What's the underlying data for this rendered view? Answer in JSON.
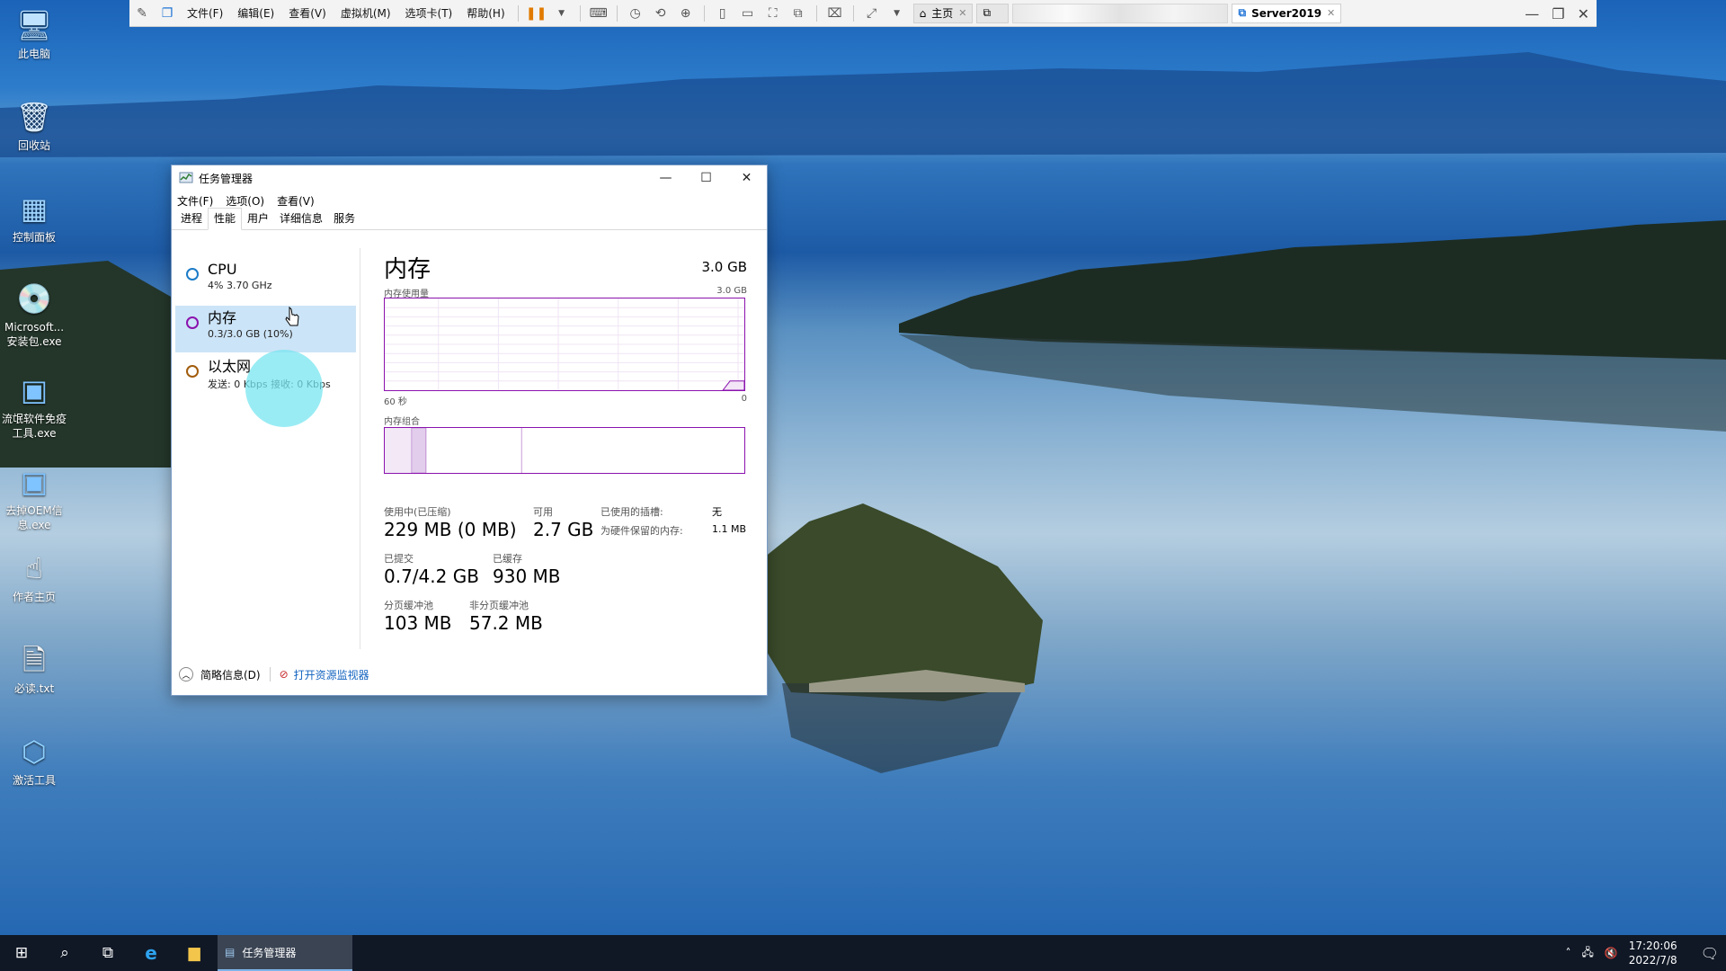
{
  "vm_toolbar": {
    "menus": [
      "文件(F)",
      "编辑(E)",
      "查看(V)",
      "虚拟机(M)",
      "选项卡(T)",
      "帮助(H)"
    ],
    "home_tab": "主页",
    "active_tab": "Server2019"
  },
  "desktop_icons": [
    {
      "label": "此电脑",
      "icon": "computer-icon"
    },
    {
      "label": "回收站",
      "icon": "recycle-bin-icon"
    },
    {
      "label": "控制面板",
      "icon": "control-panel-icon"
    },
    {
      "label": "Microsoft... 安装包.exe",
      "icon": "installer-disc-icon"
    },
    {
      "label": "流氓软件免疫工具.exe",
      "icon": "exe-app-icon"
    },
    {
      "label": "去掉OEM信息.exe",
      "icon": "exe-app-icon"
    },
    {
      "label": "作者主页",
      "icon": "hand-pointer-icon"
    },
    {
      "label": "必读.txt",
      "icon": "text-file-icon"
    },
    {
      "label": "激活工具",
      "icon": "package-icon"
    }
  ],
  "task_manager": {
    "title": "任务管理器",
    "menu": [
      "文件(F)",
      "选项(O)",
      "查看(V)"
    ],
    "tabs": [
      "进程",
      "性能",
      "用户",
      "详细信息",
      "服务"
    ],
    "active_tab": "性能",
    "resources": [
      {
        "name": "CPU",
        "detail": "4% 3.70 GHz",
        "color": "#1c7bc7"
      },
      {
        "name": "内存",
        "detail": "0.3/3.0 GB (10%)",
        "color": "#8b12ae",
        "selected": true
      },
      {
        "name": "以太网",
        "detail": "发送: 0 Kbps 接收: 0 Kbps",
        "color": "#a15c0c"
      }
    ],
    "memory": {
      "title": "内存",
      "total": "3.0 GB",
      "usage_label": "内存使用量",
      "usage_max": "3.0 GB",
      "time_left": "60 秒",
      "time_right": "0",
      "composition_label": "内存组合",
      "in_use_label": "使用中(已压缩)",
      "in_use_value": "229 MB (0 MB)",
      "available_label": "可用",
      "available_value": "2.7 GB",
      "slots_label": "已使用的插槽:",
      "slots_value": "无",
      "reserved_label": "为硬件保留的内存:",
      "reserved_value": "1.1 MB",
      "committed_label": "已提交",
      "committed_value": "0.7/4.2 GB",
      "cached_label": "已缓存",
      "cached_value": "930 MB",
      "paged_label": "分页缓冲池",
      "paged_value": "103 MB",
      "nonpaged_label": "非分页缓冲池",
      "nonpaged_value": "57.2 MB",
      "usage_fraction": 0.1
    },
    "footer": {
      "fewer_details": "简略信息(D)",
      "open_resmon": "打开资源监视器"
    }
  },
  "taskbar": {
    "active_app": "任务管理器",
    "time": "17:20:06",
    "date": "2022/7/8"
  }
}
